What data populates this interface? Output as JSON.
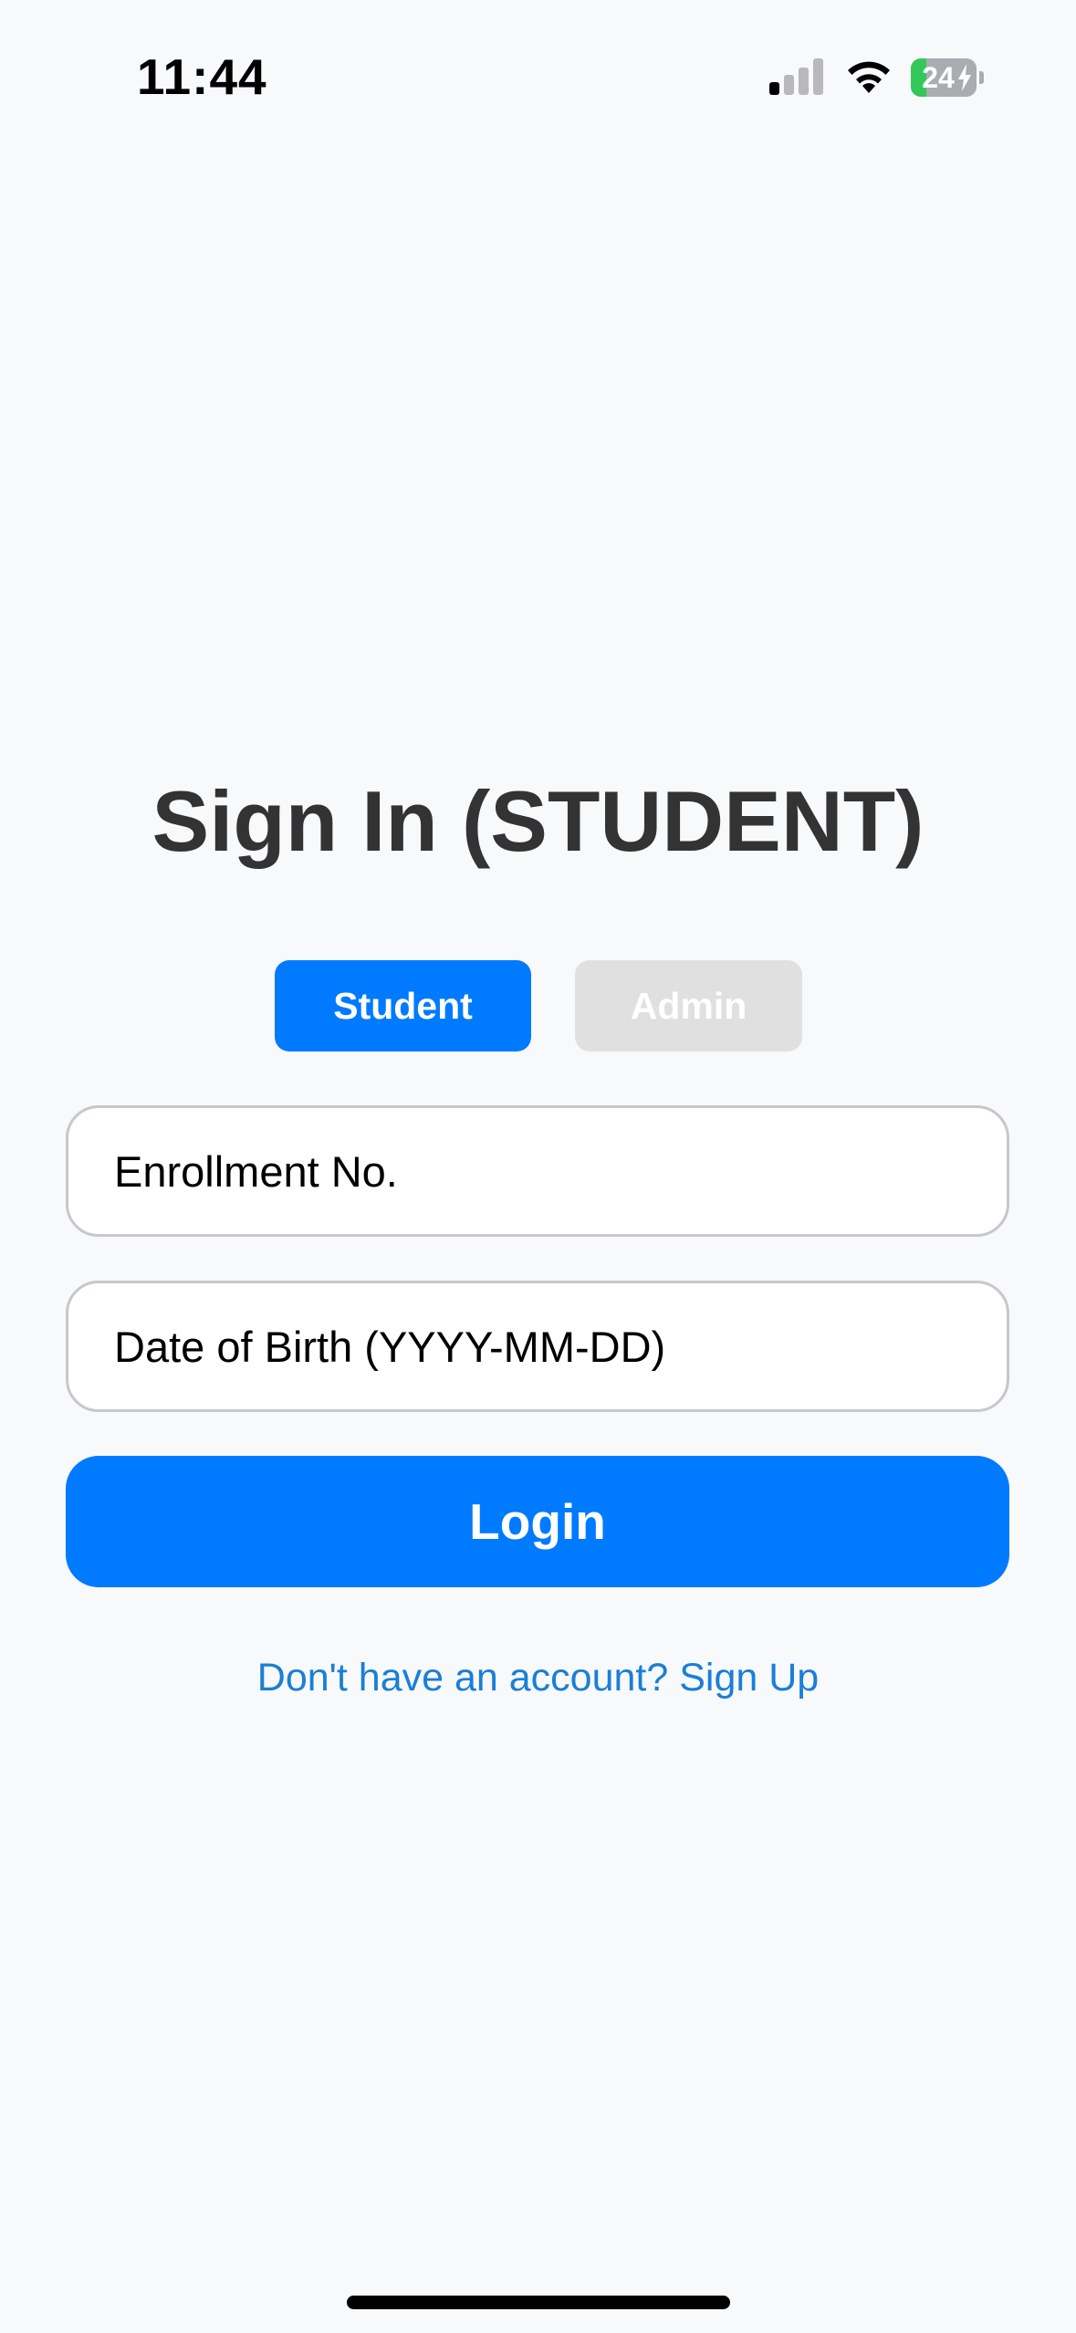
{
  "status_bar": {
    "time": "11:44",
    "battery_level": "24",
    "battery_percent": 24,
    "signal_bars_active": 1,
    "signal_bars_total": 4,
    "battery_charging": true
  },
  "title": "Sign In (STUDENT)",
  "role_toggle": {
    "student_label": "Student",
    "admin_label": "Admin",
    "selected": "Student"
  },
  "form": {
    "enrollment_placeholder": "Enrollment No.",
    "enrollment_value": "",
    "dob_placeholder": "Date of Birth (YYYY-MM-DD)",
    "dob_value": "",
    "login_label": "Login"
  },
  "signup_link": "Don't have an account? Sign Up",
  "colors": {
    "primary": "#007aff",
    "background": "#f7f9fb",
    "title_text": "#333333",
    "inactive_button": "#e0e0e0",
    "link": "#1a7fd6",
    "battery_fill": "#34c759"
  }
}
